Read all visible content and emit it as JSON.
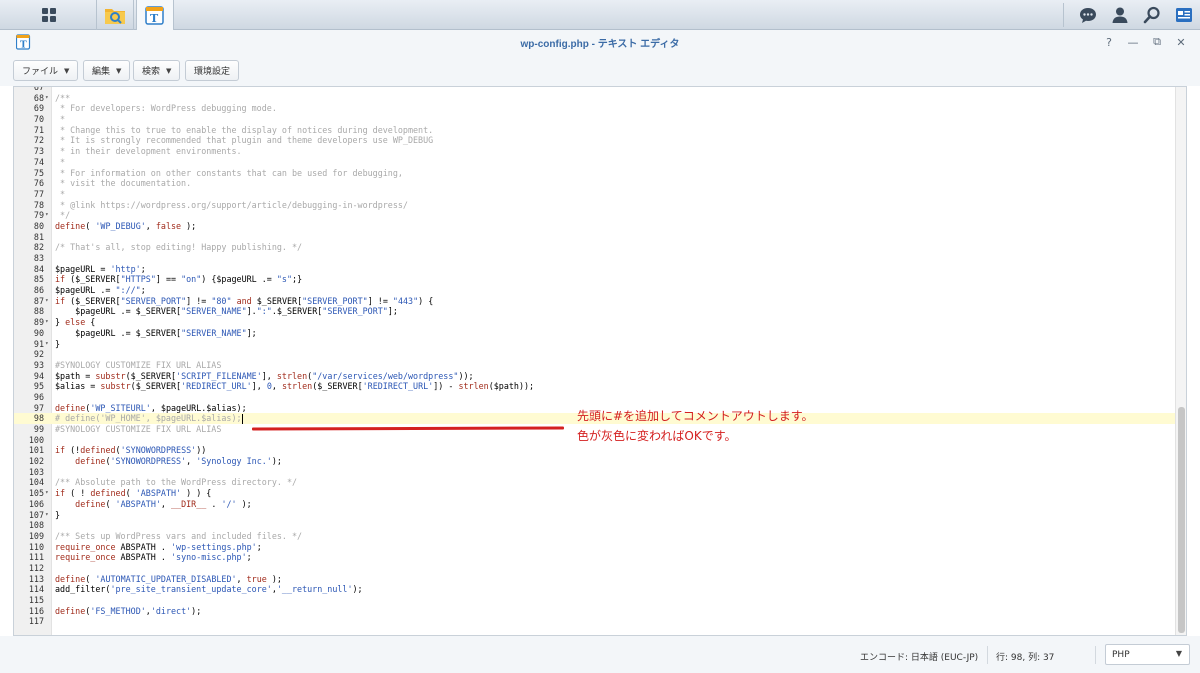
{
  "taskbar": {
    "main_menu_icon": "grid-icon",
    "apps": [
      {
        "icon": "file-station-icon"
      },
      {
        "icon": "text-editor-icon"
      }
    ],
    "right_icons": [
      "chat-icon",
      "user-icon",
      "search-icon",
      "widgets-icon"
    ]
  },
  "window": {
    "title": "wp-config.php - テキスト エディタ",
    "controls": [
      "?",
      "—",
      "⧉",
      "✕"
    ]
  },
  "toolbar": {
    "file_label": "ファイル",
    "edit_label": "編集",
    "search_label": "検索",
    "settings_label": "環境設定"
  },
  "editor": {
    "active_line": 98,
    "lines": [
      {
        "n": "67",
        "fold": false,
        "segs": [
          [
            "c-com",
            "          "
          ]
        ]
      },
      {
        "n": "68",
        "fold": true,
        "segs": [
          [
            "c-com",
            "/**"
          ]
        ]
      },
      {
        "n": "69",
        "fold": false,
        "segs": [
          [
            "c-com",
            " * For developers: WordPress debugging mode."
          ]
        ]
      },
      {
        "n": "70",
        "fold": false,
        "segs": [
          [
            "c-com",
            " *"
          ]
        ]
      },
      {
        "n": "71",
        "fold": false,
        "segs": [
          [
            "c-com",
            " * Change this to true to enable the display of notices during development."
          ]
        ]
      },
      {
        "n": "72",
        "fold": false,
        "segs": [
          [
            "c-com",
            " * It is strongly recommended that plugin and theme developers use WP_DEBUG"
          ]
        ]
      },
      {
        "n": "73",
        "fold": false,
        "segs": [
          [
            "c-com",
            " * in their development environments."
          ]
        ]
      },
      {
        "n": "74",
        "fold": false,
        "segs": [
          [
            "c-com",
            " *"
          ]
        ]
      },
      {
        "n": "75",
        "fold": false,
        "segs": [
          [
            "c-com",
            " * For information on other constants that can be used for debugging,"
          ]
        ]
      },
      {
        "n": "76",
        "fold": false,
        "segs": [
          [
            "c-com",
            " * visit the documentation."
          ]
        ]
      },
      {
        "n": "77",
        "fold": false,
        "segs": [
          [
            "c-com",
            " *"
          ]
        ]
      },
      {
        "n": "78",
        "fold": false,
        "segs": [
          [
            "c-com",
            " * @link https://wordpress.org/support/article/debugging-in-wordpress/"
          ]
        ]
      },
      {
        "n": "79",
        "fold": true,
        "segs": [
          [
            "c-com",
            " */"
          ]
        ]
      },
      {
        "n": "80",
        "fold": false,
        "segs": [
          [
            "c-kw",
            "define"
          ],
          [
            "c-var",
            "( "
          ],
          [
            "c-str",
            "'WP_DEBUG'"
          ],
          [
            "c-var",
            ", "
          ],
          [
            "c-kw",
            "false"
          ],
          [
            "c-var",
            " );"
          ]
        ]
      },
      {
        "n": "81",
        "fold": false,
        "segs": []
      },
      {
        "n": "82",
        "fold": false,
        "segs": [
          [
            "c-com",
            "/* That's all, stop editing! Happy publishing. */"
          ]
        ]
      },
      {
        "n": "83",
        "fold": false,
        "segs": []
      },
      {
        "n": "84",
        "fold": false,
        "segs": [
          [
            "c-var",
            "$pageURL = "
          ],
          [
            "c-str",
            "'http'"
          ],
          [
            "c-var",
            ";"
          ]
        ]
      },
      {
        "n": "85",
        "fold": false,
        "segs": [
          [
            "c-kw",
            "if"
          ],
          [
            "c-var",
            " ($_SERVER["
          ],
          [
            "c-str",
            "\"HTTPS\""
          ],
          [
            "c-var",
            "] == "
          ],
          [
            "c-str",
            "\"on\""
          ],
          [
            "c-var",
            ") {$pageURL .= "
          ],
          [
            "c-str",
            "\"s\""
          ],
          [
            "c-var",
            ";}"
          ]
        ]
      },
      {
        "n": "86",
        "fold": false,
        "segs": [
          [
            "c-var",
            "$pageURL .= "
          ],
          [
            "c-str",
            "\"://\""
          ],
          [
            "c-var",
            ";"
          ]
        ]
      },
      {
        "n": "87",
        "fold": true,
        "segs": [
          [
            "c-kw",
            "if"
          ],
          [
            "c-var",
            " ($_SERVER["
          ],
          [
            "c-str",
            "\"SERVER_PORT\""
          ],
          [
            "c-var",
            "] != "
          ],
          [
            "c-str",
            "\"80\""
          ],
          [
            "c-var",
            " "
          ],
          [
            "c-kw",
            "and"
          ],
          [
            "c-var",
            " $_SERVER["
          ],
          [
            "c-str",
            "\"SERVER_PORT\""
          ],
          [
            "c-var",
            "] != "
          ],
          [
            "c-str",
            "\"443\""
          ],
          [
            "c-var",
            ") {"
          ]
        ]
      },
      {
        "n": "88",
        "fold": false,
        "segs": [
          [
            "c-var",
            "    $pageURL .= $_SERVER["
          ],
          [
            "c-str",
            "\"SERVER_NAME\""
          ],
          [
            "c-var",
            "]."
          ],
          [
            "c-str",
            "\":\""
          ],
          [
            "c-var",
            ".$_SERVER["
          ],
          [
            "c-str",
            "\"SERVER_PORT\""
          ],
          [
            "c-var",
            "];"
          ]
        ]
      },
      {
        "n": "89",
        "fold": true,
        "segs": [
          [
            "c-var",
            "} "
          ],
          [
            "c-kw",
            "else"
          ],
          [
            "c-var",
            " {"
          ]
        ]
      },
      {
        "n": "90",
        "fold": false,
        "segs": [
          [
            "c-var",
            "    $pageURL .= $_SERVER["
          ],
          [
            "c-str",
            "\"SERVER_NAME\""
          ],
          [
            "c-var",
            "];"
          ]
        ]
      },
      {
        "n": "91",
        "fold": true,
        "segs": [
          [
            "c-var",
            "}"
          ]
        ]
      },
      {
        "n": "92",
        "fold": false,
        "segs": []
      },
      {
        "n": "93",
        "fold": false,
        "segs": [
          [
            "c-com",
            "#SYNOLOGY CUSTOMIZE FIX URL ALIAS"
          ]
        ]
      },
      {
        "n": "94",
        "fold": false,
        "segs": [
          [
            "c-var",
            "$path = "
          ],
          [
            "c-kw",
            "substr"
          ],
          [
            "c-var",
            "($_SERVER["
          ],
          [
            "c-str",
            "'SCRIPT_FILENAME'"
          ],
          [
            "c-var",
            "], "
          ],
          [
            "c-kw",
            "strlen"
          ],
          [
            "c-var",
            "("
          ],
          [
            "c-str",
            "\"/var/services/web/wordpress\""
          ],
          [
            "c-var",
            "));"
          ]
        ]
      },
      {
        "n": "95",
        "fold": false,
        "segs": [
          [
            "c-var",
            "$alias = "
          ],
          [
            "c-kw",
            "substr"
          ],
          [
            "c-var",
            "($_SERVER["
          ],
          [
            "c-str",
            "'REDIRECT_URL'"
          ],
          [
            "c-var",
            "], "
          ],
          [
            "c-str",
            "0"
          ],
          [
            "c-var",
            ", "
          ],
          [
            "c-kw",
            "strlen"
          ],
          [
            "c-var",
            "($_SERVER["
          ],
          [
            "c-str",
            "'REDIRECT_URL'"
          ],
          [
            "c-var",
            "]) - "
          ],
          [
            "c-kw",
            "strlen"
          ],
          [
            "c-var",
            "($path));"
          ]
        ]
      },
      {
        "n": "96",
        "fold": false,
        "segs": []
      },
      {
        "n": "97",
        "fold": false,
        "segs": [
          [
            "c-kw",
            "define"
          ],
          [
            "c-var",
            "("
          ],
          [
            "c-str",
            "'WP_SITEURL'"
          ],
          [
            "c-var",
            ", $pageURL.$alias);"
          ]
        ]
      },
      {
        "n": "98",
        "fold": false,
        "segs": [
          [
            "c-com",
            "# define('WP_HOME', $pageURL.$alias);"
          ]
        ]
      },
      {
        "n": "99",
        "fold": false,
        "segs": [
          [
            "c-com",
            "#SYNOLOGY CUSTOMIZE FIX URL ALIAS"
          ]
        ]
      },
      {
        "n": "100",
        "fold": false,
        "segs": []
      },
      {
        "n": "101",
        "fold": false,
        "segs": [
          [
            "c-kw",
            "if"
          ],
          [
            "c-var",
            " (!"
          ],
          [
            "c-kw",
            "defined"
          ],
          [
            "c-var",
            "("
          ],
          [
            "c-str",
            "'SYNOWORDPRESS'"
          ],
          [
            "c-var",
            "))"
          ]
        ]
      },
      {
        "n": "102",
        "fold": false,
        "segs": [
          [
            "c-var",
            "    "
          ],
          [
            "c-kw",
            "define"
          ],
          [
            "c-var",
            "("
          ],
          [
            "c-str",
            "'SYNOWORDPRESS'"
          ],
          [
            "c-var",
            ", "
          ],
          [
            "c-str",
            "'Synology Inc.'"
          ],
          [
            "c-var",
            ");"
          ]
        ]
      },
      {
        "n": "103",
        "fold": false,
        "segs": []
      },
      {
        "n": "104",
        "fold": false,
        "segs": [
          [
            "c-com",
            "/** Absolute path to the WordPress directory. */"
          ]
        ]
      },
      {
        "n": "105",
        "fold": true,
        "segs": [
          [
            "c-kw",
            "if"
          ],
          [
            "c-var",
            " ( ! "
          ],
          [
            "c-kw",
            "defined"
          ],
          [
            "c-var",
            "( "
          ],
          [
            "c-str",
            "'ABSPATH'"
          ],
          [
            "c-var",
            " ) ) {"
          ]
        ]
      },
      {
        "n": "106",
        "fold": false,
        "segs": [
          [
            "c-var",
            "    "
          ],
          [
            "c-kw",
            "define"
          ],
          [
            "c-var",
            "( "
          ],
          [
            "c-str",
            "'ABSPATH'"
          ],
          [
            "c-var",
            ", "
          ],
          [
            "c-kw",
            "__DIR__"
          ],
          [
            "c-var",
            " . "
          ],
          [
            "c-str",
            "'/'"
          ],
          [
            "c-var",
            " );"
          ]
        ]
      },
      {
        "n": "107",
        "fold": true,
        "segs": [
          [
            "c-var",
            "}"
          ]
        ]
      },
      {
        "n": "108",
        "fold": false,
        "segs": []
      },
      {
        "n": "109",
        "fold": false,
        "segs": [
          [
            "c-com",
            "/** Sets up WordPress vars and included files. */"
          ]
        ]
      },
      {
        "n": "110",
        "fold": false,
        "segs": [
          [
            "c-kw",
            "require_once"
          ],
          [
            "c-var",
            " ABSPATH . "
          ],
          [
            "c-str",
            "'wp-settings.php'"
          ],
          [
            "c-var",
            ";"
          ]
        ]
      },
      {
        "n": "111",
        "fold": false,
        "segs": [
          [
            "c-kw",
            "require_once"
          ],
          [
            "c-var",
            " ABSPATH . "
          ],
          [
            "c-str",
            "'syno-misc.php'"
          ],
          [
            "c-var",
            ";"
          ]
        ]
      },
      {
        "n": "112",
        "fold": false,
        "segs": []
      },
      {
        "n": "113",
        "fold": false,
        "segs": [
          [
            "c-kw",
            "define"
          ],
          [
            "c-var",
            "( "
          ],
          [
            "c-str",
            "'AUTOMATIC_UPDATER_DISABLED'"
          ],
          [
            "c-var",
            ", "
          ],
          [
            "c-kw",
            "true"
          ],
          [
            "c-var",
            " );"
          ]
        ]
      },
      {
        "n": "114",
        "fold": false,
        "segs": [
          [
            "c-var",
            "add_filter("
          ],
          [
            "c-str",
            "'pre_site_transient_update_core'"
          ],
          [
            "c-var",
            ","
          ],
          [
            "c-str",
            "'__return_null'"
          ],
          [
            "c-var",
            ");"
          ]
        ]
      },
      {
        "n": "115",
        "fold": false,
        "segs": []
      },
      {
        "n": "116",
        "fold": false,
        "segs": [
          [
            "c-kw",
            "define"
          ],
          [
            "c-var",
            "("
          ],
          [
            "c-str",
            "'FS_METHOD'"
          ],
          [
            "c-var",
            ","
          ],
          [
            "c-str",
            "'direct'"
          ],
          [
            "c-var",
            ");"
          ]
        ]
      },
      {
        "n": "117",
        "fold": false,
        "segs": []
      }
    ]
  },
  "annotation": {
    "line1": "先頭に#を追加してコメントアウトします。",
    "line2": "色が灰色に変わればOKです。",
    "color": "#d42020"
  },
  "status": {
    "encoding": "エンコード: 日本語 (EUC-JP)",
    "position": "行: 98, 列: 37",
    "language": "PHP"
  }
}
